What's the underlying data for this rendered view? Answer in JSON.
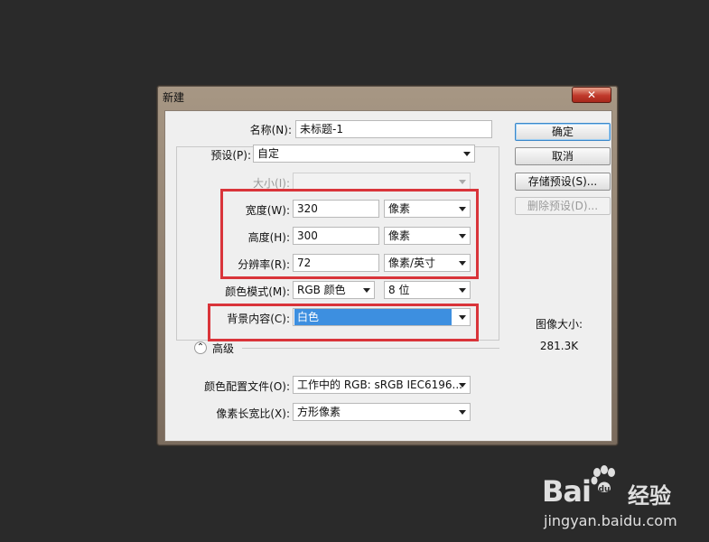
{
  "dialog": {
    "title": "新建",
    "close_symbol": "✕"
  },
  "form": {
    "name_label": "名称(N):",
    "name_value": "未标题-1",
    "preset_label": "预设(P):",
    "preset_value": "自定",
    "size_label": "大小(I):",
    "size_value": "",
    "width_label": "宽度(W):",
    "width_value": "320",
    "width_unit": "像素",
    "height_label": "高度(H):",
    "height_value": "300",
    "height_unit": "像素",
    "resolution_label": "分辨率(R):",
    "resolution_value": "72",
    "resolution_unit": "像素/英寸",
    "color_mode_label": "颜色模式(M):",
    "color_mode_value": "RGB 颜色",
    "bit_depth_value": "8 位",
    "background_label": "背景内容(C):",
    "background_value": "白色",
    "advanced_label": "高级",
    "advanced_icon": "expand-up-icon",
    "color_profile_label": "颜色配置文件(O):",
    "color_profile_value": "工作中的 RGB: sRGB IEC6196...",
    "pixel_aspect_label": "像素长宽比(X):",
    "pixel_aspect_value": "方形像素"
  },
  "buttons": {
    "ok": "确定",
    "cancel": "取消",
    "save_preset": "存储预设(S)...",
    "delete_preset": "删除预设(D)..."
  },
  "image_size": {
    "label": "图像大小:",
    "value": "281.3K"
  },
  "watermark": {
    "logo": "Bai",
    "logo_cn": "经验",
    "url": "jingyan.baidu.com"
  },
  "colors": {
    "highlight": "#d9343a",
    "selection": "#3d8fe0",
    "close_button": "#c0392b"
  }
}
